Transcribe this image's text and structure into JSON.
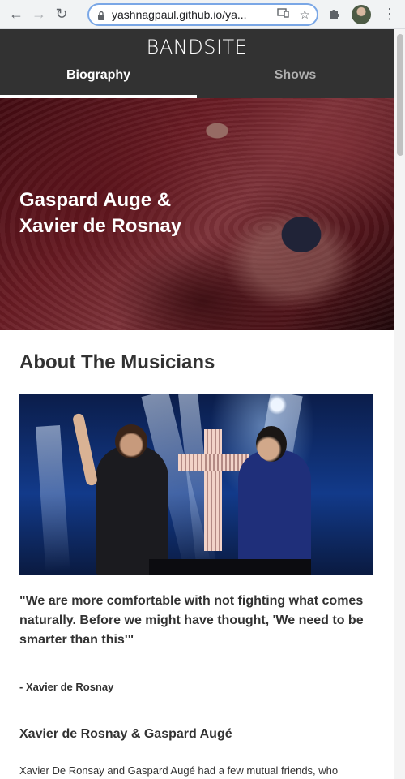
{
  "browser": {
    "url": "yashnagpaul.github.io/ya..."
  },
  "header": {
    "logo": "BANDSITE",
    "tabs": [
      {
        "label": "Biography",
        "active": true
      },
      {
        "label": "Shows",
        "active": false
      }
    ]
  },
  "hero": {
    "title_line1": "Gaspard Auge &",
    "title_line2": "Xavier de Rosnay"
  },
  "about": {
    "title": "About The Musicians",
    "quote": "\"We are more comfortable with not fighting what comes naturally. Before we might have thought, 'We need to be smarter than this'\"",
    "quote_author": "- Xavier de Rosnay",
    "subheading": "Xavier de Rosnay & Gaspard Augé",
    "body": "Xavier De Ronsay and Gaspard Augé had a few mutual friends, who"
  },
  "colors": {
    "header_bg": "#323232",
    "text": "#323232",
    "tab_inactive": "#afafaf"
  }
}
